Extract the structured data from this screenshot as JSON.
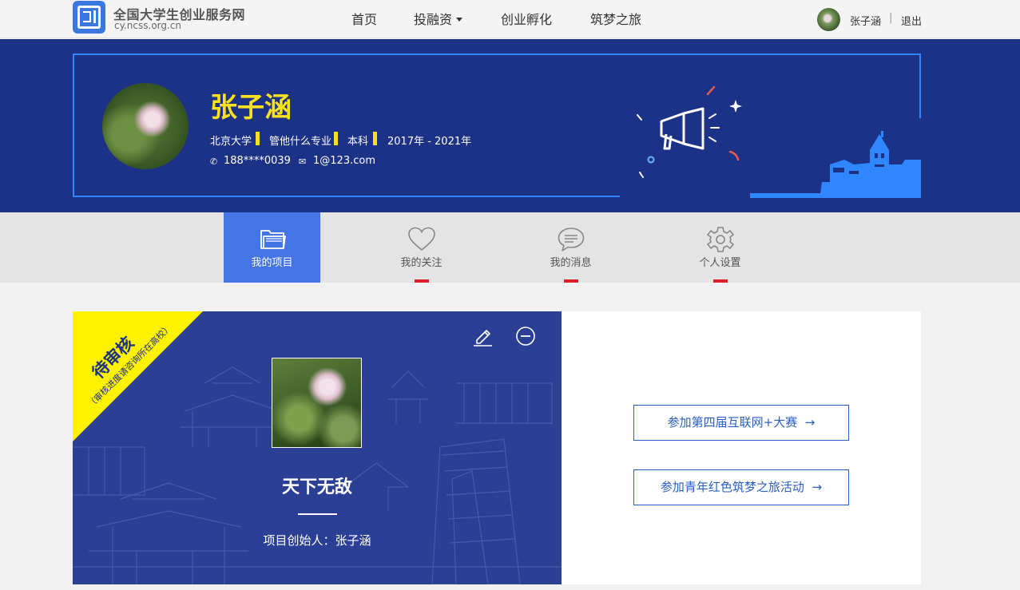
{
  "header": {
    "site_title": "全国大学生创业服务网",
    "site_domain": "cy.ncss.org.cn",
    "nav": [
      "首页",
      "投融资",
      "创业孵化",
      "筑梦之旅"
    ],
    "user_name": "张子涵",
    "separator": "|",
    "logout": "退出"
  },
  "profile": {
    "name": "张子涵",
    "school": "北京大学",
    "major": "管他什么专业",
    "degree": "本科",
    "years": "2017年 - 2021年",
    "phone": "188****0039",
    "email": "1@123.com",
    "phone_icon": "✆",
    "email_icon": "✉"
  },
  "tabs": [
    {
      "label": "我的项目",
      "icon": "folder-icon",
      "active": true
    },
    {
      "label": "我的关注",
      "icon": "heart-icon",
      "active": false
    },
    {
      "label": "我的消息",
      "icon": "chat-bubble-icon",
      "active": false
    },
    {
      "label": "个人设置",
      "icon": "gear-icon",
      "active": false
    }
  ],
  "project": {
    "status": "待审核",
    "status_note": "（审核进度请咨询所在高校）",
    "title": "天下无敌",
    "founder": "项目创始人：张子涵"
  },
  "actions": {
    "join_competition": "参加第四届互联网+大赛",
    "join_tour": "参加青年红色筑梦之旅活动",
    "arrow": "→"
  },
  "colors": {
    "banner_bg": "#1c3287",
    "accent_blue": "#2f86ff",
    "name_yellow": "#f9e21d",
    "tab_active": "#4575e4",
    "card_bg": "#2b3f95",
    "ribbon_yellow": "#fff200",
    "badge_red": "#d8212a"
  }
}
